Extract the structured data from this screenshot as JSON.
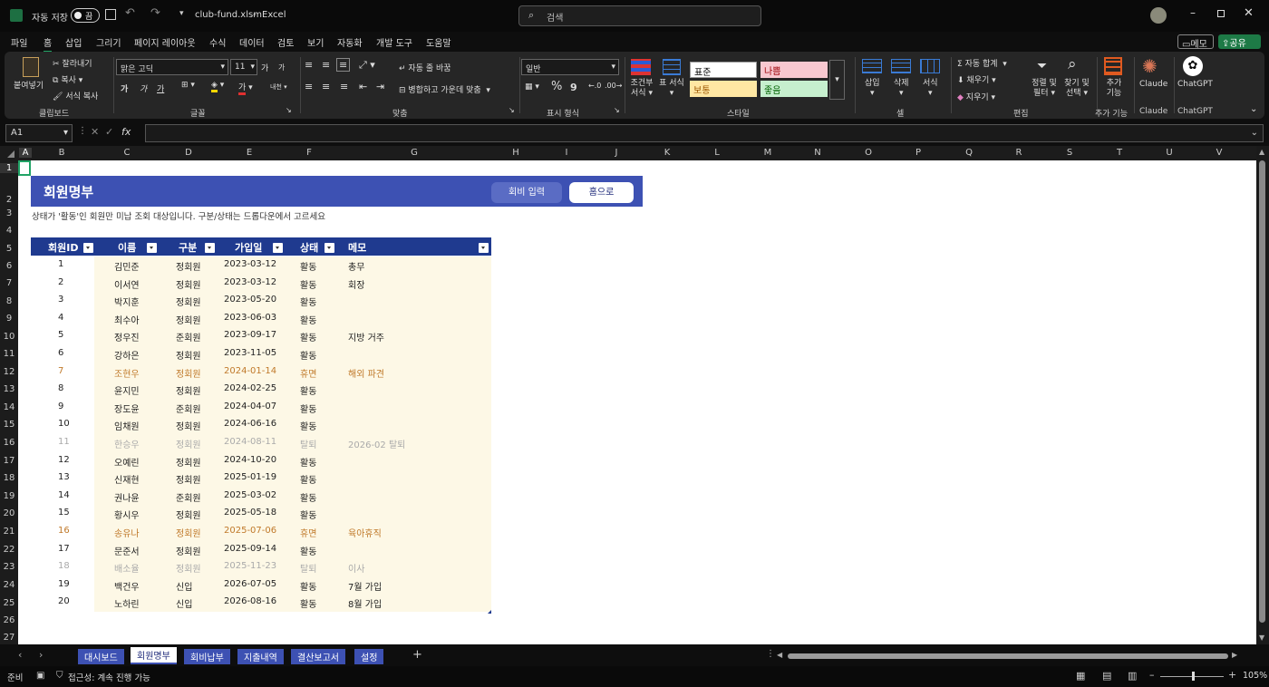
{
  "titlebar": {
    "autosave": "자동 저장",
    "toggle": "끔",
    "filename": "club-fund.xlsm",
    "dash": "-",
    "app": "Excel",
    "search_placeholder": "검색"
  },
  "menu": [
    "파일",
    "홈",
    "삽입",
    "그리기",
    "페이지 레이아웃",
    "수식",
    "데이터",
    "검토",
    "보기",
    "자동화",
    "개발 도구",
    "도움말"
  ],
  "menu_right": {
    "memo": "메모",
    "share": "공유"
  },
  "ribbon": {
    "clipboard": {
      "paste": "붙여넣기",
      "cut": "잘라내기",
      "copy": "복사",
      "format_painter": "서식 복사",
      "label": "클립보드"
    },
    "font": {
      "name": "맑은 고딕",
      "size": "11",
      "grow": "가",
      "shrink": "가",
      "bold": "가",
      "italic": "가",
      "underline": "가",
      "phonetic": "내천",
      "label": "글꼴"
    },
    "align": {
      "wrap": "자동 줄 바꿈",
      "merge": "병합하고 가운데 맞춤",
      "label": "맞춤"
    },
    "number": {
      "format": "일반",
      "percent": "%",
      "comma": "9",
      "label": "표시 형식"
    },
    "styles": {
      "cond": "조건부 서식",
      "table": "표 서식",
      "normal": "표준",
      "bad": "나쁨",
      "neutral": "보통",
      "good": "좋음",
      "label": "스타일"
    },
    "cells": {
      "insert": "삽입",
      "delete": "삭제",
      "format": "서식",
      "label": "셀"
    },
    "editing": {
      "autosum": "자동 합계",
      "fill": "채우기",
      "clear": "지우기",
      "sort": "정렬 및 필터",
      "find": "찾기 및 선택",
      "label": "편집"
    },
    "addins": {
      "addins": "추가 기능",
      "label": "추가 기능"
    },
    "claude": {
      "name": "Claude",
      "label": "Claude"
    },
    "chatgpt": {
      "name": "ChatGPT",
      "label": "ChatGPT"
    }
  },
  "formula": {
    "namebox": "A1",
    "fx": "fx"
  },
  "columns": [
    "A",
    "B",
    "C",
    "D",
    "E",
    "F",
    "G",
    "H",
    "I",
    "J",
    "K",
    "L",
    "M",
    "N",
    "O",
    "P",
    "Q",
    "R",
    "S",
    "T",
    "U",
    "V"
  ],
  "rows": [
    "1",
    "2",
    "3",
    "4",
    "5",
    "6",
    "7",
    "8",
    "9",
    "10",
    "11",
    "12",
    "13",
    "14",
    "15",
    "16",
    "17",
    "18",
    "19",
    "20",
    "21",
    "22",
    "23",
    "24",
    "25",
    "26",
    "27"
  ],
  "sheet": {
    "title": "회원명부",
    "btn_fee": "회비 입력",
    "btn_home": "홈으로",
    "subtitle": "상태가 '활동'인 회원만 미납 조회 대상입니다. 구분/상태는 드롭다운에서 고르세요",
    "headers": [
      "회원ID",
      "이름",
      "구분",
      "가입일",
      "상태",
      "메모"
    ],
    "members": [
      {
        "id": "1",
        "name": "김민준",
        "type": "정회원",
        "date": "2023-03-12",
        "status": "활동",
        "memo": "총무",
        "state": "active"
      },
      {
        "id": "2",
        "name": "이서연",
        "type": "정회원",
        "date": "2023-03-12",
        "status": "활동",
        "memo": "회장",
        "state": "active"
      },
      {
        "id": "3",
        "name": "박지훈",
        "type": "정회원",
        "date": "2023-05-20",
        "status": "활동",
        "memo": "",
        "state": "active"
      },
      {
        "id": "4",
        "name": "최수아",
        "type": "정회원",
        "date": "2023-06-03",
        "status": "활동",
        "memo": "",
        "state": "active"
      },
      {
        "id": "5",
        "name": "정우진",
        "type": "준회원",
        "date": "2023-09-17",
        "status": "활동",
        "memo": "지방 거주",
        "state": "active"
      },
      {
        "id": "6",
        "name": "강하은",
        "type": "정회원",
        "date": "2023-11-05",
        "status": "활동",
        "memo": "",
        "state": "active"
      },
      {
        "id": "7",
        "name": "조현우",
        "type": "정회원",
        "date": "2024-01-14",
        "status": "휴면",
        "memo": "해외 파견",
        "state": "dormant"
      },
      {
        "id": "8",
        "name": "윤지민",
        "type": "정회원",
        "date": "2024-02-25",
        "status": "활동",
        "memo": "",
        "state": "active"
      },
      {
        "id": "9",
        "name": "장도윤",
        "type": "준회원",
        "date": "2024-04-07",
        "status": "활동",
        "memo": "",
        "state": "active"
      },
      {
        "id": "10",
        "name": "임채원",
        "type": "정회원",
        "date": "2024-06-16",
        "status": "활동",
        "memo": "",
        "state": "active"
      },
      {
        "id": "11",
        "name": "한승우",
        "type": "정회원",
        "date": "2024-08-11",
        "status": "탈퇴",
        "memo": "2026-02 탈퇴",
        "state": "left"
      },
      {
        "id": "12",
        "name": "오예린",
        "type": "정회원",
        "date": "2024-10-20",
        "status": "활동",
        "memo": "",
        "state": "active"
      },
      {
        "id": "13",
        "name": "신재현",
        "type": "정회원",
        "date": "2025-01-19",
        "status": "활동",
        "memo": "",
        "state": "active"
      },
      {
        "id": "14",
        "name": "권나윤",
        "type": "준회원",
        "date": "2025-03-02",
        "status": "활동",
        "memo": "",
        "state": "active"
      },
      {
        "id": "15",
        "name": "황시우",
        "type": "정회원",
        "date": "2025-05-18",
        "status": "활동",
        "memo": "",
        "state": "active"
      },
      {
        "id": "16",
        "name": "송유나",
        "type": "정회원",
        "date": "2025-07-06",
        "status": "휴면",
        "memo": "육아휴직",
        "state": "dormant"
      },
      {
        "id": "17",
        "name": "문준서",
        "type": "정회원",
        "date": "2025-09-14",
        "status": "활동",
        "memo": "",
        "state": "active"
      },
      {
        "id": "18",
        "name": "배소율",
        "type": "정회원",
        "date": "2025-11-23",
        "status": "탈퇴",
        "memo": "이사",
        "state": "left"
      },
      {
        "id": "19",
        "name": "백건우",
        "type": "신입",
        "date": "2026-07-05",
        "status": "활동",
        "memo": "7월 가입",
        "state": "active"
      },
      {
        "id": "20",
        "name": "노하린",
        "type": "신입",
        "date": "2026-08-16",
        "status": "활동",
        "memo": "8월 가입",
        "state": "active"
      }
    ]
  },
  "tabs": [
    "대시보드",
    "회원명부",
    "회비납부",
    "지출내역",
    "결산보고서",
    "설정"
  ],
  "status": {
    "ready": "준비",
    "accessibility": "접근성: 계속 진행 가능",
    "zoom": "105%"
  },
  "colors": {
    "banner": "#3d51b3",
    "header": "#1f3a8f",
    "row_bg": "#fdf8e6",
    "dormant": "#c0792a",
    "left": "#aaaaaa",
    "active": "#222222"
  }
}
